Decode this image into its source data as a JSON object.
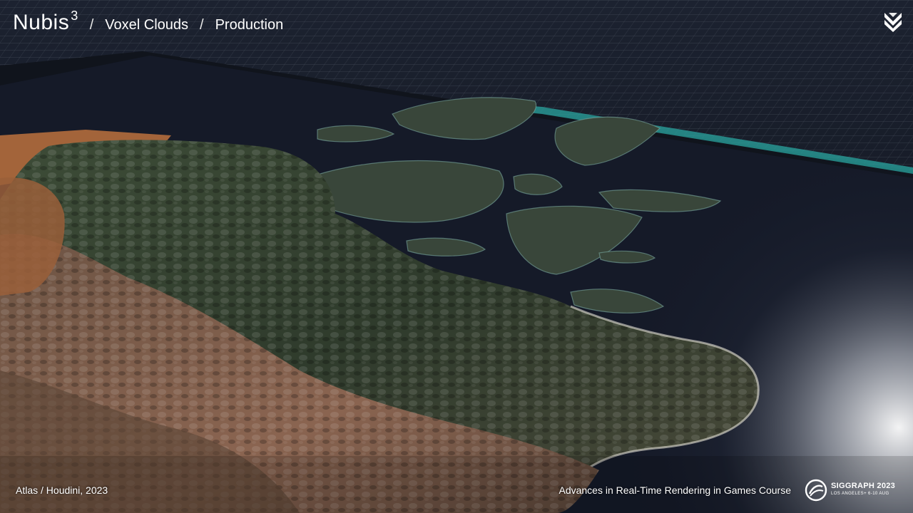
{
  "header": {
    "brand": "Nubis",
    "brand_superscript": "3",
    "separator": "/",
    "breadcrumb": [
      "Voxel Clouds",
      "Production"
    ]
  },
  "scene": {
    "subject": "3D terrain heightfield with islands and water over a grid plane",
    "colors": {
      "background": "#0d1118",
      "grid_line": "#6a7280",
      "water": "#141826",
      "water_edge": "#2aa6a0",
      "terrain_green": "#3a4a33",
      "terrain_brown": "#7a5a44",
      "desert": "#b06a3c"
    }
  },
  "icons": {
    "corner_logo": "studio-logo-icon",
    "siggraph_logo": "siggraph-logo-icon"
  },
  "footer": {
    "credit": "Atlas / Houdini, 2023",
    "course": "Advances in Real-Time Rendering in Games Course",
    "siggraph_title": "SIGGRAPH 2023",
    "siggraph_sub": "LOS ANGELES+ 6-10 AUG"
  }
}
